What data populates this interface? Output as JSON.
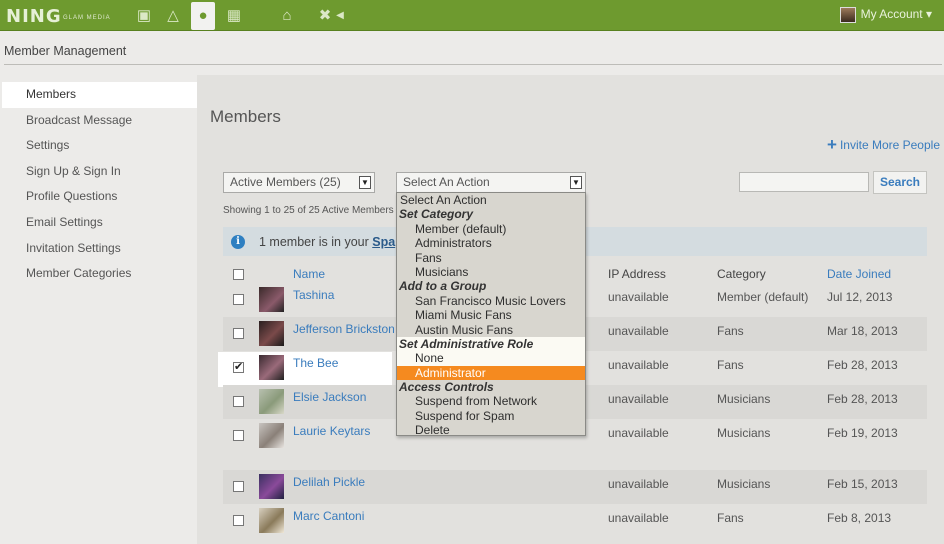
{
  "topbar": {
    "logo": "NING",
    "logo_sub": "GLAM MEDIA",
    "account_label": "My Account ▾"
  },
  "section_title": "Member Management",
  "sidebar": {
    "items": [
      {
        "label": "Members"
      },
      {
        "label": "Broadcast Message"
      },
      {
        "label": "Settings"
      },
      {
        "label": "Sign Up & Sign In"
      },
      {
        "label": "Profile Questions"
      },
      {
        "label": "Email Settings"
      },
      {
        "label": "Invitation Settings"
      },
      {
        "label": "Member Categories"
      }
    ]
  },
  "main": {
    "title": "Members",
    "invite_label": "Invite More People",
    "filter_select": "Active Members (25)",
    "action_select": "Select An Action",
    "search_value": "",
    "search_button": "Search",
    "showing": "Showing 1 to 25 of 25 Active Members",
    "notice_prefix": "1 member is in your ",
    "notice_link": "Spa",
    "headers": {
      "name": "Name",
      "ip": "IP Address",
      "category": "Category",
      "date": "Date Joined"
    },
    "rows": [
      {
        "name": "Tashina",
        "ip": "unavailable",
        "category": "Member (default)",
        "date": "Jul 12, 2013",
        "checked": false
      },
      {
        "name": "Jefferson Brickston",
        "ip": "unavailable",
        "category": "Fans",
        "date": "Mar 18, 2013",
        "checked": false
      },
      {
        "name": "The Bee",
        "ip": "unavailable",
        "category": "Fans",
        "date": "Feb 28, 2013",
        "checked": true
      },
      {
        "name": "Elsie Jackson",
        "ip": "unavailable",
        "category": "Musicians",
        "date": "Feb 28, 2013",
        "checked": false
      },
      {
        "name": "Laurie Keytars",
        "ip": "unavailable",
        "category": "Musicians",
        "date": "Feb 19, 2013",
        "checked": false
      },
      {
        "name": "Delilah Pickle",
        "ip": "unavailable",
        "category": "Musicians",
        "date": "Feb 15, 2013",
        "checked": false
      },
      {
        "name": "Marc Cantoni",
        "ip": "unavailable",
        "category": "Fans",
        "date": "Feb 8, 2013",
        "checked": false
      }
    ]
  },
  "dropdown": {
    "items": [
      {
        "label": "Select An Action",
        "kind": "top"
      },
      {
        "label": "Set Category",
        "kind": "group"
      },
      {
        "label": "Member (default)",
        "kind": "option"
      },
      {
        "label": "Administrators",
        "kind": "option"
      },
      {
        "label": "Fans",
        "kind": "option"
      },
      {
        "label": "Musicians",
        "kind": "option"
      },
      {
        "label": "Add to a Group",
        "kind": "group"
      },
      {
        "label": "San Francisco Music Lovers",
        "kind": "option"
      },
      {
        "label": "Miami Music Fans",
        "kind": "option"
      },
      {
        "label": "Austin Music Fans",
        "kind": "option"
      },
      {
        "label": "Set Administrative Role",
        "kind": "group"
      },
      {
        "label": "None",
        "kind": "option"
      },
      {
        "label": "Administrator",
        "kind": "option",
        "selected": true
      },
      {
        "label": "Access Controls",
        "kind": "group"
      },
      {
        "label": "Suspend from Network",
        "kind": "option"
      },
      {
        "label": "Suspend for Spam",
        "kind": "option"
      },
      {
        "label": "Delete",
        "kind": "option"
      }
    ]
  },
  "colors": {
    "brand_green": "#6e9a2f",
    "link_blue": "#3a7cbd",
    "selected_orange": "#f58a1f"
  },
  "icons": [
    "tv-icon",
    "apps-icon",
    "member-icon",
    "dashboard-icon",
    "home-icon",
    "tools-icon",
    "collapse-arrow-icon",
    "info-icon",
    "plus-icon"
  ]
}
